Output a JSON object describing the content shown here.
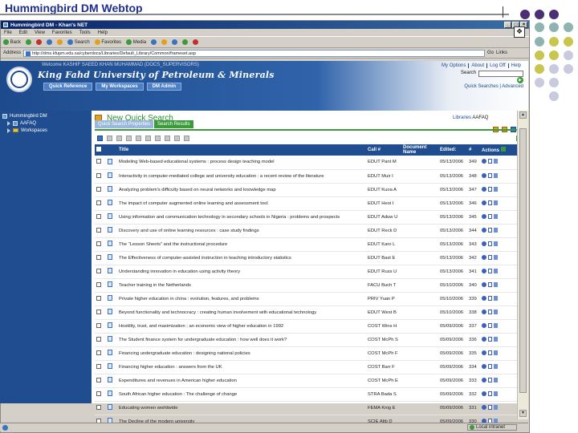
{
  "slide": {
    "title": "Hummingbird DM Webtop"
  },
  "window": {
    "title": "Hummingbird DM - Khan's NET",
    "buttons": [
      "_",
      "□",
      "×"
    ]
  },
  "menu": [
    "File",
    "Edit",
    "View",
    "Favorites",
    "Tools",
    "Help"
  ],
  "toolbar": {
    "back": "Back",
    "search": "Search",
    "favorites": "Favorites",
    "media": "Media"
  },
  "address": {
    "label": "Address",
    "url": "http://dms.kfupm.edu.sa/cyberdocs/Libraries/Default_Library/Common/frameset.asp",
    "go": "Go",
    "links": "Links"
  },
  "header": {
    "welcome": "Welcome KASHIF SAEED KHAN MUHAMMAD (DOCS_SUPERVISORS)",
    "university": "King Fahd University of Petroleum & Minerals",
    "tabs": [
      "Quick Reference",
      "My Workspaces",
      "DM Admin"
    ],
    "links": [
      "My Options",
      "About",
      "Log Off",
      "Help"
    ],
    "search_label": "Search",
    "search_links": "Quick Searches | Advanced"
  },
  "tree": {
    "root": "Hummingbird DM",
    "items": [
      "AAFAQ",
      "Workspaces"
    ]
  },
  "main": {
    "title": "New Quick Search",
    "libraries_label": "Libraries",
    "library_value": "AAFAQ",
    "tabs": [
      "Quick Search Properties",
      "Search Results"
    ]
  },
  "table": {
    "columns": [
      "Title",
      "Call #",
      "Document Name",
      "Edited:",
      "#",
      "Actions"
    ],
    "rows": [
      {
        "title": "Modeling Web-based educational systems : process design teaching model",
        "call": "EDUT Pant M",
        "edited": "05/13/2006",
        "num": "349"
      },
      {
        "title": "Interactivity in computer-mediated college and university education : a recent review of the literature",
        "call": "EDUT Muir I",
        "edited": "05/13/2006",
        "num": "348"
      },
      {
        "title": "Analyzing problem's difficulty based on neural networks and knowledge map",
        "call": "EDUT Kuoa A",
        "edited": "05/13/2006",
        "num": "347"
      },
      {
        "title": "The impact of computer augmented online learning and assessment tool",
        "call": "EDUT Heoi I",
        "edited": "05/13/2006",
        "num": "346"
      },
      {
        "title": "Using information and communication technology in secondary schools in Nigeria : problems and prospects",
        "call": "EDUT Aduw U",
        "edited": "05/13/2006",
        "num": "345"
      },
      {
        "title": "Discovery and use of online learning resources : case study findings",
        "call": "EDUT Reck D",
        "edited": "05/13/2006",
        "num": "344"
      },
      {
        "title": "The \"Lesson Sheets\" and the instructional procedure",
        "call": "EDUT Karo L",
        "edited": "05/13/2006",
        "num": "343"
      },
      {
        "title": "The Effectiveness of computer-assisted instruction in teaching introductory statistics",
        "call": "EDUT Bast E",
        "edited": "05/13/2006",
        "num": "342"
      },
      {
        "title": "Understanding innovation in education using activity theory",
        "call": "EDUT Russ U",
        "edited": "05/13/2006",
        "num": "341"
      },
      {
        "title": "Teacher training in the Netherlands",
        "call": "FACU Buch T",
        "edited": "05/10/2006",
        "num": "340"
      },
      {
        "title": "Private higher education in china : evolution, features, and problems",
        "call": "PRIV Yuan P",
        "edited": "05/10/2006",
        "num": "339"
      },
      {
        "title": "Beyond functionality and technocracy : creating human involvement with educational technology",
        "call": "EDUT West B",
        "edited": "05/10/2006",
        "num": "338"
      },
      {
        "title": "Hostility, trust, and maximization ; an economic view of higher education in 1992",
        "call": "COST Wins H",
        "edited": "05/09/2006",
        "num": "337"
      },
      {
        "title": "The Student finance system for undergraduate education : how well does it work?",
        "call": "COST McPh S",
        "edited": "05/09/2006",
        "num": "336"
      },
      {
        "title": "Financing undergraduate education : designing national policies",
        "call": "COST McPh F",
        "edited": "05/09/2006",
        "num": "335"
      },
      {
        "title": "Financing higher education : answers from the UK",
        "call": "COST Barr F",
        "edited": "05/09/2006",
        "num": "334"
      },
      {
        "title": "Expenditures and revenues in American higher education",
        "call": "COST McPh E",
        "edited": "05/09/2006",
        "num": "333"
      },
      {
        "title": "South African higher education : The challenge of change",
        "call": "STRA Bada S",
        "edited": "05/09/2006",
        "num": "332"
      },
      {
        "title": "Educating women worldwide",
        "call": "FEMA Knig E",
        "edited": "05/09/2006",
        "num": "331"
      },
      {
        "title": "The Decline of the modern university",
        "call": "SCIE Altb D",
        "edited": "05/09/2006",
        "num": "330"
      }
    ]
  },
  "status": {
    "zone": "Local intranet"
  },
  "colors": {
    "header_blue": "#1f4d8f",
    "accent_green": "#3c9a3c",
    "dot_purple": "#4b2f73",
    "dot_teal": "#8fb3b0",
    "dot_olive": "#c9c64f",
    "dot_lavender": "#c9c9e0"
  }
}
